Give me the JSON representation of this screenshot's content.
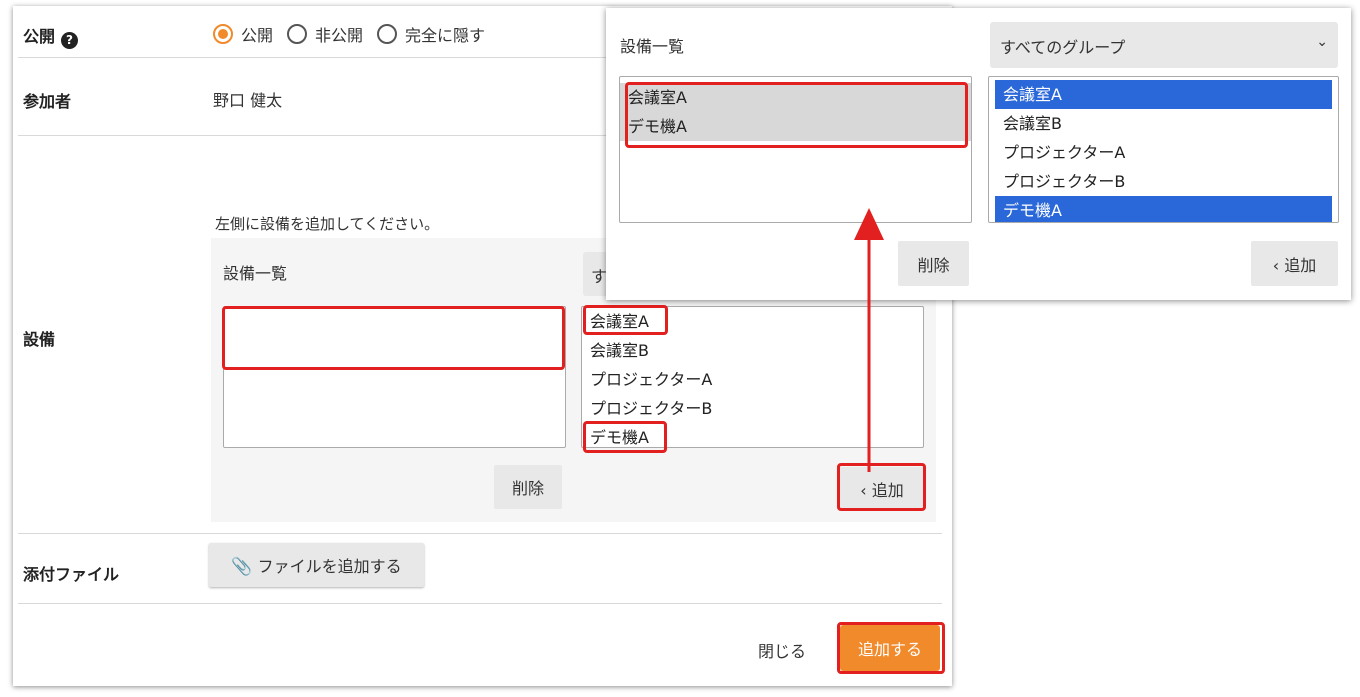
{
  "visibility": {
    "label": "公開",
    "options": [
      {
        "label": "公開",
        "checked": true
      },
      {
        "label": "非公開",
        "checked": false
      },
      {
        "label": "完全に隠す",
        "checked": false
      }
    ]
  },
  "participants": {
    "label": "参加者",
    "value": "野口 健太"
  },
  "facility": {
    "label": "設備",
    "hint": "左側に設備を追加してください。",
    "list_label": "設備一覧",
    "group_select_partial": "す",
    "available": [
      "会議室A",
      "会議室B",
      "プロジェクターA",
      "プロジェクターB",
      "デモ機A"
    ],
    "remove_label": "削除",
    "add_label": "追加"
  },
  "attachment": {
    "label": "添付ファイル",
    "button": "ファイルを追加する"
  },
  "footer": {
    "close_label": "閉じる",
    "submit_label": "追加する"
  },
  "popup": {
    "list_label": "設備一覧",
    "group_select": "すべてのグループ",
    "selected": [
      "会議室A",
      "デモ機A"
    ],
    "available": [
      "会議室A",
      "会議室B",
      "プロジェクターA",
      "プロジェクターB",
      "デモ機A"
    ],
    "remove_label": "削除",
    "add_label": "追加"
  },
  "colors": {
    "accent": "#f08a2a",
    "highlight": "#e32020",
    "selection": "#2a67d8"
  }
}
